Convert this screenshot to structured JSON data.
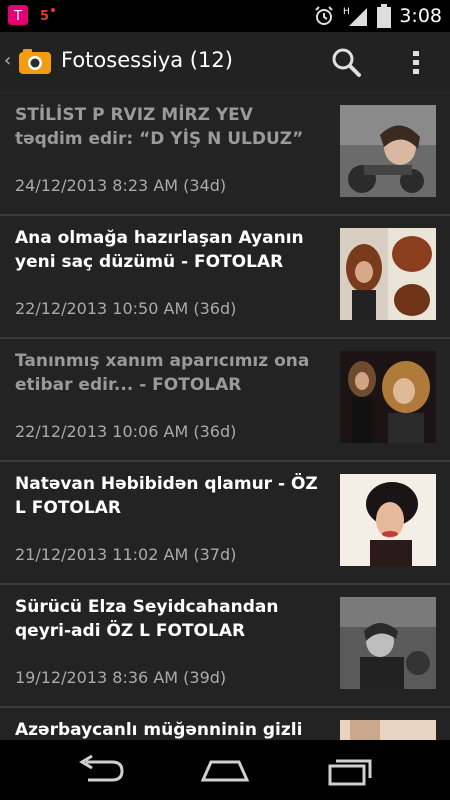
{
  "status": {
    "time": "3:08",
    "network": "H"
  },
  "action_bar": {
    "title": "Fotosessiya (12)"
  },
  "articles": [
    {
      "title": "STİLİST P RVIZ MİRZ YEV təqdim edir: “D YİŞ N ULDUZ”",
      "date": "24/12/2013 8:23 AM (34d)"
    },
    {
      "title": "Ana olmağa hazırlaşan Ayanın yeni saç düzümü - FOTOLAR",
      "date": "22/12/2013 10:50 AM (36d)"
    },
    {
      "title": "Tanınmış xanım aparıcımız ona etibar edir... - FOTOLAR",
      "date": "22/12/2013 10:06 AM (36d)"
    },
    {
      "title": "Natəvan Həbibidən qlamur - ÖZ L FOTOLAR",
      "date": "21/12/2013 11:02 AM (37d)"
    },
    {
      "title": "Sürücü Elza Seyidcahandan qeyri-adi ÖZ L FOTOLAR",
      "date": "19/12/2013 8:36 AM (39d)"
    },
    {
      "title": "Azərbaycanlı müğənninin gizli toy",
      "date": ""
    }
  ]
}
